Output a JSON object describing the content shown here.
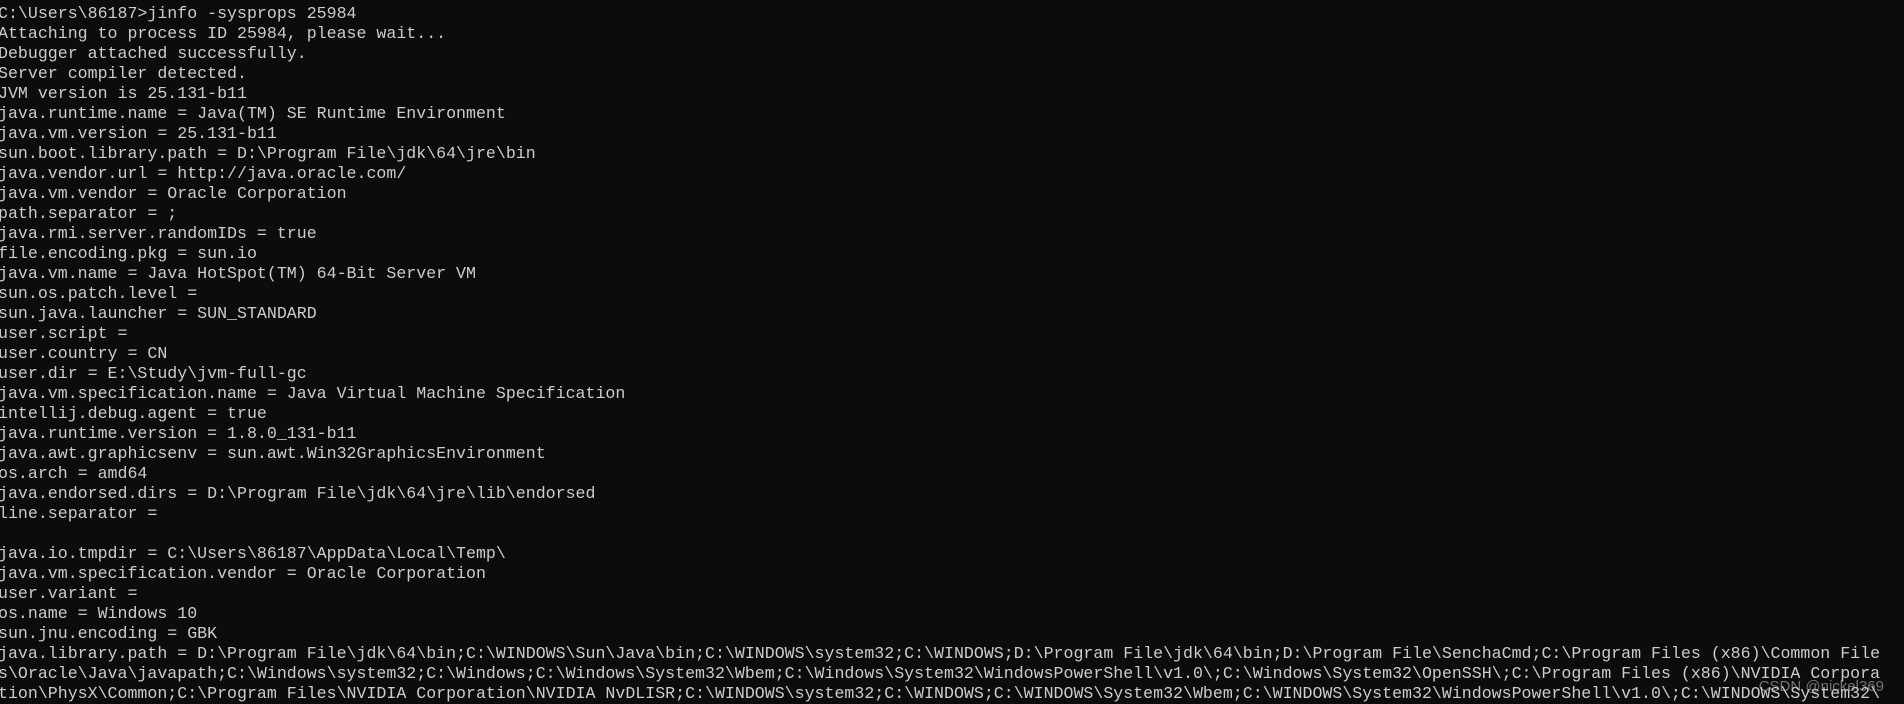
{
  "window": {
    "type": "command-prompt",
    "background": "#0c0c0c",
    "foreground": "#cccccc"
  },
  "console": {
    "lines": [
      "C:\\Users\\86187>jinfo -sysprops 25984",
      "Attaching to process ID 25984, please wait...",
      "Debugger attached successfully.",
      "Server compiler detected.",
      "JVM version is 25.131-b11",
      "java.runtime.name = Java(TM) SE Runtime Environment",
      "java.vm.version = 25.131-b11",
      "sun.boot.library.path = D:\\Program File\\jdk\\64\\jre\\bin",
      "java.vendor.url = http://java.oracle.com/",
      "java.vm.vendor = Oracle Corporation",
      "path.separator = ;",
      "java.rmi.server.randomIDs = true",
      "file.encoding.pkg = sun.io",
      "java.vm.name = Java HotSpot(TM) 64-Bit Server VM",
      "sun.os.patch.level =",
      "sun.java.launcher = SUN_STANDARD",
      "user.script =",
      "user.country = CN",
      "user.dir = E:\\Study\\jvm-full-gc",
      "java.vm.specification.name = Java Virtual Machine Specification",
      "intellij.debug.agent = true",
      "java.runtime.version = 1.8.0_131-b11",
      "java.awt.graphicsenv = sun.awt.Win32GraphicsEnvironment",
      "os.arch = amd64",
      "java.endorsed.dirs = D:\\Program File\\jdk\\64\\jre\\lib\\endorsed",
      "line.separator =",
      "",
      "java.io.tmpdir = C:\\Users\\86187\\AppData\\Local\\Temp\\",
      "java.vm.specification.vendor = Oracle Corporation",
      "user.variant =",
      "os.name = Windows 10",
      "sun.jnu.encoding = GBK",
      "java.library.path = D:\\Program File\\jdk\\64\\bin;C:\\WINDOWS\\Sun\\Java\\bin;C:\\WINDOWS\\system32;C:\\WINDOWS;D:\\Program File\\jdk\\64\\bin;D:\\Program File\\SenchaCmd;C:\\Program Files (x86)\\Common File",
      "s\\Oracle\\Java\\javapath;C:\\Windows\\system32;C:\\Windows;C:\\Windows\\System32\\Wbem;C:\\Windows\\System32\\WindowsPowerShell\\v1.0\\;C:\\Windows\\System32\\OpenSSH\\;C:\\Program Files (x86)\\NVIDIA Corpora",
      "tion\\PhysX\\Common;C:\\Program Files\\NVIDIA Corporation\\NVIDIA NvDLISR;C:\\WINDOWS\\system32;C:\\WINDOWS;C:\\WINDOWS\\System32\\Wbem;C:\\WINDOWS\\System32\\WindowsPowerShell\\v1.0\\;C:\\WINDOWS\\System32\\"
    ]
  },
  "watermark": "CSDN @nickel369"
}
